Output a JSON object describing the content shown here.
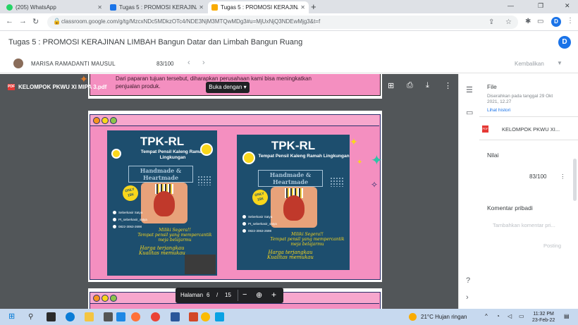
{
  "browser": {
    "tabs": [
      {
        "label": "(205) WhatsApp",
        "color": "#25d366"
      },
      {
        "label": "Tugas 5 : PROMOSI KERAJINAN",
        "color": "#1a73e8"
      },
      {
        "label": "Tugas 5 : PROMOSI KERAJINAN",
        "color": "#f9ab00"
      }
    ],
    "new_tab": "+",
    "url": "classroom.google.com/g/tg/MzcxNDc5MDkzOTc4/NDE3NjM3MTQwMDg3#u=MjUxNjQ3NDEwMjg3&t=f",
    "profile_initial": "D"
  },
  "classroom": {
    "title": "Tugas 5 : PROMOSI KERAJINAN LIMBAH Bangun Datar dan Limbah Bangun Ruang",
    "student_name": "MARISA RAMADANTI MAUSUL",
    "grade": "83/100",
    "return_label": "Kembalikan"
  },
  "pdf": {
    "file_name": "KELOMPOK PKWU XI MIPA 3.pdf",
    "open_with": "Buka dengan",
    "page_text_line1": "Dari paparan tujuan tersebut, diharapkan perusahaan kami bisa meningkatkan",
    "page_text_line2": "penjualan produk.",
    "page_label": "Halaman",
    "page_current": "6",
    "page_sep": "/",
    "page_total": "15"
  },
  "poster": {
    "title": "TPK-RL",
    "subtitle": "Tempat Pensil Kaleng Ramah Lingkungan",
    "handmade": "Handmade & Heartmade",
    "only": "ONLY 15K",
    "tagline1": "Miliki Segera!!",
    "tagline2": "Tempat pensil yang mempercantik meja belajarmu",
    "price1": "Harga terjangkau",
    "price2": "Kualitas memukau",
    "social": [
      "Seberkasir Satya",
      "Pt_seberkasir_satya",
      "0822-3063-2698"
    ]
  },
  "panel": {
    "file_heading": "File",
    "submitted": "Diserahkan pada tanggal 29 Okt 2021, 12.27",
    "history": "Lihat histori",
    "attachment": "KELOMPOK PKWU XI...",
    "grade_heading": "Nilai",
    "grade_value": "83/100",
    "comment_heading": "Komentar pribadi",
    "comment_placeholder": "Tambahkan komentar pri...",
    "post_label": "Posting"
  },
  "taskbar": {
    "weather": "21°C  Hujan ringan",
    "time": "11:32 PM",
    "date": "23-Feb-22"
  }
}
